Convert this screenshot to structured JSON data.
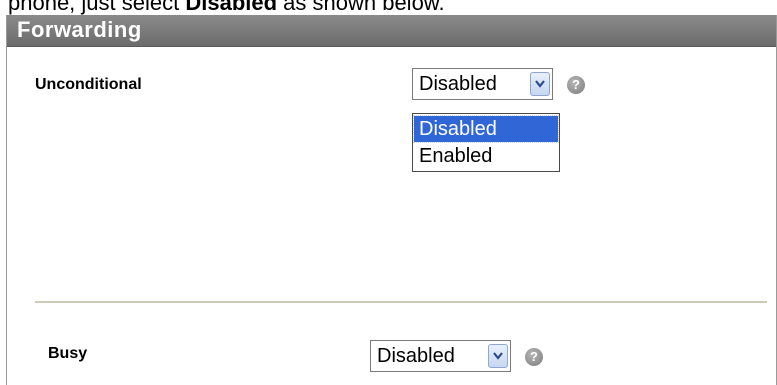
{
  "instruction": {
    "prefix": "phone, just select ",
    "emphasis": "Disabled",
    "suffix": " as shown below."
  },
  "panel": {
    "title": "Forwarding"
  },
  "unconditional": {
    "label": "Unconditional",
    "selected": "Disabled",
    "options": [
      "Disabled",
      "Enabled"
    ],
    "highlighted_option": "Disabled",
    "help": "?"
  },
  "busy": {
    "label": "Busy",
    "selected": "Disabled",
    "help": "?"
  },
  "colors": {
    "header": "#787878",
    "highlight": "#3166d6"
  }
}
